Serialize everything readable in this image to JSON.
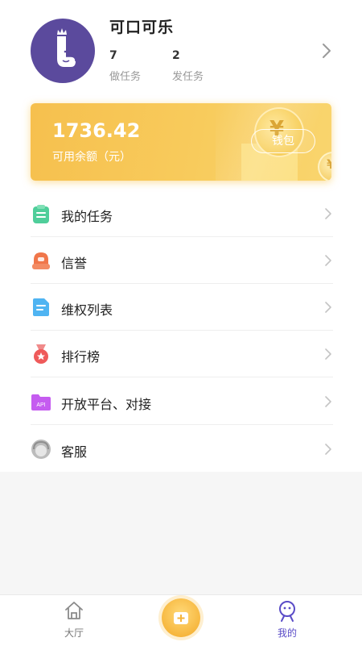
{
  "profile": {
    "username": "可口可乐",
    "stats": [
      {
        "count": "7",
        "label": "做任务"
      },
      {
        "count": "2",
        "label": "发任务"
      }
    ]
  },
  "wallet": {
    "balance": "1736.42",
    "balance_label": "可用余额（元）",
    "button_label": "钱包"
  },
  "menu": [
    {
      "label": "我的任务",
      "icon": "clipboard-icon",
      "color": "#4fce9a"
    },
    {
      "label": "信誉",
      "icon": "credit-badge-icon",
      "color": "#f0764a"
    },
    {
      "label": "维权列表",
      "icon": "document-icon",
      "color": "#4fb4f2"
    },
    {
      "label": "排行榜",
      "icon": "medal-icon",
      "color": "#ef5a5a"
    },
    {
      "label": "开放平台、对接",
      "icon": "api-folder-icon",
      "color": "#c55cf0"
    },
    {
      "label": "客服",
      "icon": "customer-service-icon",
      "color": "#bcbcbc"
    }
  ],
  "tabbar": {
    "tabs": [
      {
        "label": "大厅",
        "icon": "home-icon",
        "active": false
      },
      {
        "label": "我的",
        "icon": "profile-icon",
        "active": true
      }
    ],
    "center_icon": "add-task-icon"
  },
  "colors": {
    "accent_purple": "#5b4a9d",
    "active_tab": "#5a4cc7",
    "card_gold": "#f7c552"
  }
}
